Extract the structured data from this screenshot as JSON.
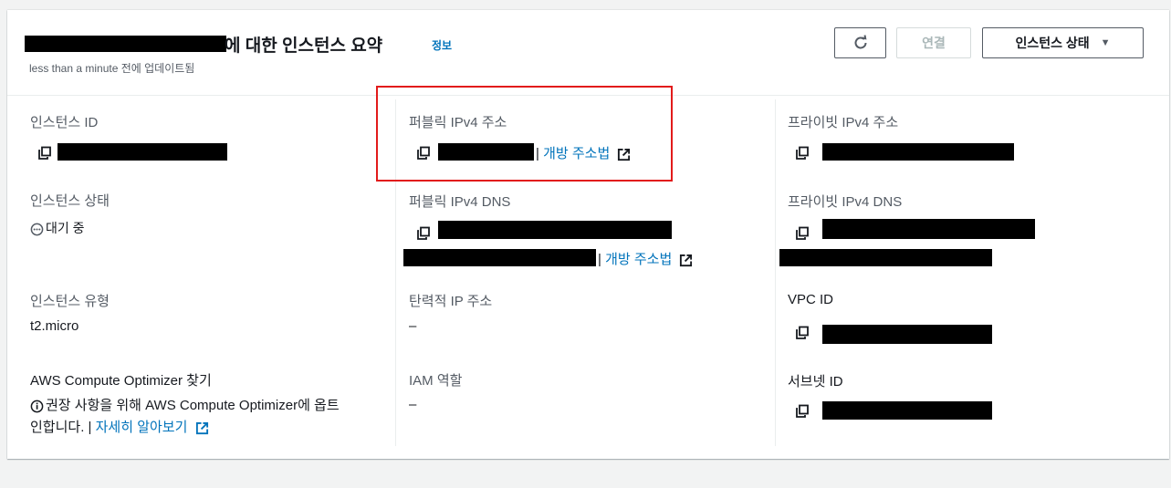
{
  "header": {
    "title_suffix": "에 대한 인스턴스 요약",
    "info_link": "정보",
    "updated_text": "less than a minute 전에 업데이트됨",
    "buttons": {
      "refresh_icon": "refresh-icon",
      "connect_label": "연결",
      "state_label": "인스턴스 상태"
    }
  },
  "fields": {
    "instance_id": {
      "label": "인스턴스 ID"
    },
    "public_ipv4": {
      "label": "퍼블릭 IPv4 주소",
      "link": "개방 주소법"
    },
    "private_ipv4": {
      "label": "프라이빗 IPv4 주소"
    },
    "instance_state": {
      "label": "인스턴스 상태",
      "value": "대기 중"
    },
    "public_dns": {
      "label": "퍼블릭 IPv4 DNS",
      "link": "개방 주소법"
    },
    "private_dns": {
      "label": "프라이빗 IPv4 DNS"
    },
    "instance_type": {
      "label": "인스턴스 유형",
      "value": "t2.micro"
    },
    "elastic_ip": {
      "label": "탄력적 IP 주소",
      "value": "–"
    },
    "vpc_id": {
      "label": "VPC ID"
    },
    "optimizer": {
      "label": "AWS Compute Optimizer 찾기",
      "line1": "권장 사항을 위해 AWS Compute Optimizer에 옵트",
      "line2": "인합니다.",
      "link": "자세히 알아보기"
    },
    "iam_role": {
      "label": "IAM 역할",
      "value": "–"
    },
    "subnet_id": {
      "label": "서브넷 ID"
    }
  },
  "separator": "|",
  "colors": {
    "link": "#0073bb",
    "highlight_border": "#e21b1b"
  }
}
